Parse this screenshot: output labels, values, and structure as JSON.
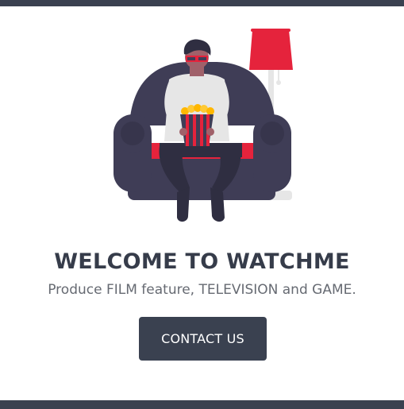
{
  "hero": {
    "illustration_icon": "person-watching-movie-illustration",
    "title": "WELCOME TO WATCHME",
    "subtitle": "Produce FILM feature, TELEVISION and GAME.",
    "cta_label": "CONTACT US"
  },
  "colors": {
    "dark": "#3a4150",
    "accent": "#e5233c",
    "title_text": "#363c4a",
    "subtitle_text": "#666a72",
    "background": "#ffffff"
  }
}
